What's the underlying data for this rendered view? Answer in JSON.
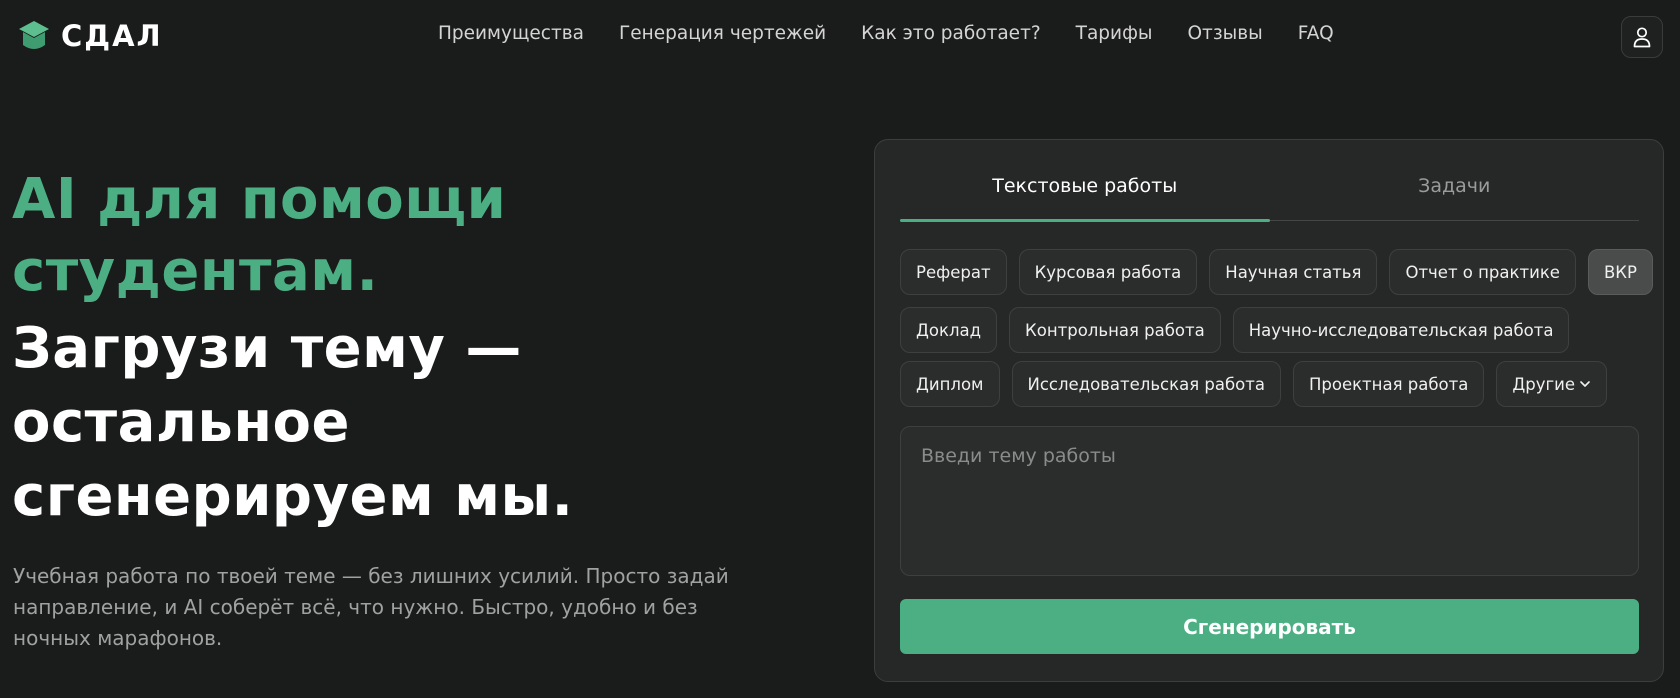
{
  "brand": {
    "name": "СДАЛ",
    "accent_color": "#4caf84",
    "logo_icon": "graduation-cap-icon"
  },
  "nav": {
    "items": [
      {
        "label": "Преимущества"
      },
      {
        "label": "Генерация чертежей"
      },
      {
        "label": "Как это работает?"
      },
      {
        "label": "Тарифы"
      },
      {
        "label": "Отзывы"
      },
      {
        "label": "FAQ"
      }
    ],
    "profile_icon": "user-icon"
  },
  "hero": {
    "headline_green": [
      "AI для помощи",
      "студентам."
    ],
    "headline_white": [
      "Загрузи тему —",
      "остальное",
      "сгенерируем мы."
    ],
    "subtitle": "Учебная работа по твоей теме — без лишних усилий. Просто задай направление, и AI соберёт всё, что нужно. Быстро, удобно и без ночных марафонов."
  },
  "panel": {
    "tabs": [
      {
        "label": "Текстовые работы",
        "active": true
      },
      {
        "label": "Задачи",
        "active": false
      }
    ],
    "chip_rows": [
      [
        {
          "label": "Реферат"
        },
        {
          "label": "Курсовая работа"
        },
        {
          "label": "Научная статья"
        },
        {
          "label": "Отчет о практике"
        },
        {
          "label": "ВКР",
          "selected": true
        }
      ],
      [
        {
          "label": "Доклад"
        },
        {
          "label": "Контрольная работа"
        },
        {
          "label": "Научно-исследовательская работа"
        }
      ],
      [
        {
          "label": "Диплом"
        },
        {
          "label": "Исследовательская работа"
        },
        {
          "label": "Проектная работа"
        },
        {
          "label": "Другие",
          "dropdown": true
        }
      ]
    ],
    "topic": {
      "value": "",
      "placeholder": "Введи тему работы"
    },
    "generate_label": "Сгенерировать"
  }
}
